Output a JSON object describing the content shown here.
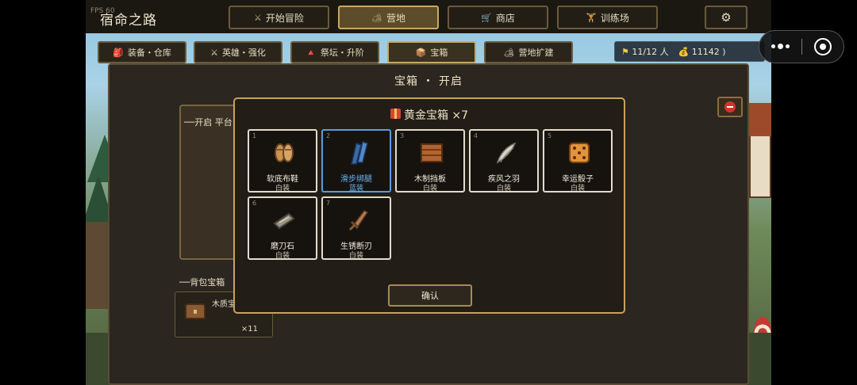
{
  "fps": "FPS 60",
  "app_title": "宿命之路",
  "nav": [
    {
      "icon": "⚔",
      "label": "开始冒险"
    },
    {
      "icon": "🏕",
      "label": "营地"
    },
    {
      "icon": "🛒",
      "label": "商店"
    },
    {
      "icon": "🏋",
      "label": "训练场"
    }
  ],
  "settings_icon": "⚙",
  "subtabs": [
    {
      "icon": "🎒",
      "label": "装备・仓库"
    },
    {
      "icon": "⚔",
      "label": "英雄・强化"
    },
    {
      "icon": "🔺",
      "label": "祭坛・升阶"
    },
    {
      "icon": "📦",
      "label": "宝箱"
    },
    {
      "icon": "🏕",
      "label": "营地扩建"
    }
  ],
  "resources": {
    "heroes_icon": "⚑",
    "heroes": "11/12 人",
    "gold_icon": "💰",
    "gold": "11142 )"
  },
  "panel": {
    "title": "宝箱 ・ 开启",
    "platform_label": "──开启 平台",
    "bag_label": "──背包宝箱",
    "bag_item_name": "木质宝",
    "bag_item_count": "×11"
  },
  "modal": {
    "title": "黄金宝箱 ×7",
    "confirm": "确认",
    "items": [
      {
        "index": "1",
        "name": "软底布鞋",
        "rarity": "白装",
        "icon": "boots-icon"
      },
      {
        "index": "2",
        "name": "滑步绑腿",
        "rarity": "蓝装",
        "icon": "leg-wraps-icon"
      },
      {
        "index": "3",
        "name": "木制挡板",
        "rarity": "白装",
        "icon": "wooden-shield-icon"
      },
      {
        "index": "4",
        "name": "疾风之羽",
        "rarity": "白装",
        "icon": "feather-icon"
      },
      {
        "index": "5",
        "name": "幸运骰子",
        "rarity": "白装",
        "icon": "dice-icon"
      },
      {
        "index": "6",
        "name": "磨刀石",
        "rarity": "白装",
        "icon": "whetstone-icon"
      },
      {
        "index": "7",
        "name": "生锈断刃",
        "rarity": "白装",
        "icon": "broken-blade-icon"
      }
    ]
  },
  "colors": {
    "gold_border": "#c8a25c",
    "blue_rarity": "#6cb2f2",
    "panel_bg": "#2b2620"
  }
}
